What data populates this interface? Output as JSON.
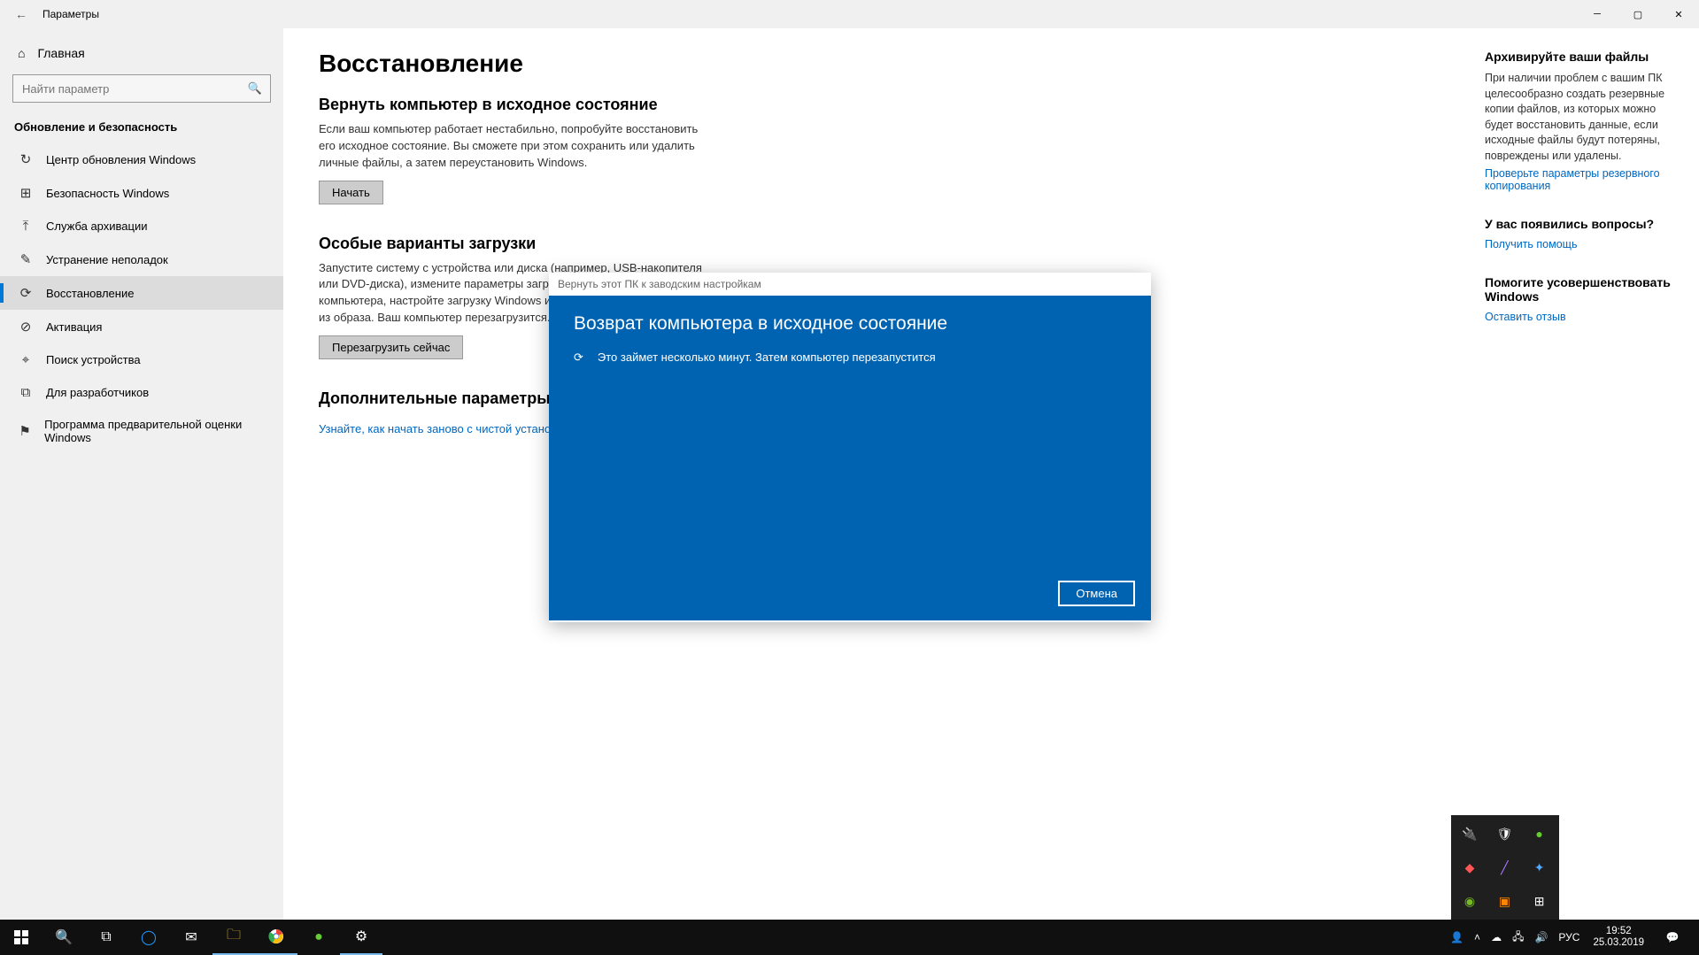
{
  "titlebar": {
    "title": "Параметры"
  },
  "sidebar": {
    "home": "Главная",
    "search_placeholder": "Найти параметр",
    "section": "Обновление и безопасность",
    "items": [
      {
        "icon": "↻",
        "label": "Центр обновления Windows"
      },
      {
        "icon": "⊞",
        "label": "Безопасность Windows"
      },
      {
        "icon": "⤒",
        "label": "Служба архивации"
      },
      {
        "icon": "✎",
        "label": "Устранение неполадок"
      },
      {
        "icon": "⟳",
        "label": "Восстановление"
      },
      {
        "icon": "⊘",
        "label": "Активация"
      },
      {
        "icon": "⌖",
        "label": "Поиск устройства"
      },
      {
        "icon": "⧉",
        "label": "Для разработчиков"
      },
      {
        "icon": "⚑",
        "label": "Программа предварительной оценки Windows"
      }
    ],
    "active_index": 4
  },
  "main": {
    "h1": "Восстановление",
    "sec1_title": "Вернуть компьютер в исходное состояние",
    "sec1_text": "Если ваш компьютер работает нестабильно, попробуйте восстановить его исходное состояние. Вы сможете при этом сохранить или удалить личные файлы, а затем переустановить Windows.",
    "sec1_btn": "Начать",
    "sec2_title": "Особые варианты загрузки",
    "sec2_text": "Запустите систему с устройства или диска (например, USB-накопителя или DVD-диска), измените параметры загрузки Windows, ПО компьютера, настройте загрузку Windows или восстановление системы из образа. Ваш компьютер перезагрузится.",
    "sec2_btn": "Перезагрузить сейчас",
    "sec3_title": "Дополнительные параметры восстановления",
    "sec3_link": "Узнайте, как начать заново с чистой установкой Windows"
  },
  "right": {
    "b1_title": "Архивируйте ваши файлы",
    "b1_text": "При наличии проблем с вашим ПК целесообразно создать резервные копии файлов, из которых можно будет восстановить данные, если исходные файлы будут потеряны, повреждены или удалены.",
    "b1_link": "Проверьте параметры резервного копирования",
    "b2_title": "У вас появились вопросы?",
    "b2_link": "Получить помощь",
    "b3_title": "Помогите усовершенствовать Windows",
    "b3_link": "Оставить отзыв"
  },
  "dialog": {
    "title": "Вернуть этот ПК к заводским настройкам",
    "heading": "Возврат компьютера в исходное состояние",
    "message": "Это займет несколько минут. Затем компьютер перезапустится",
    "cancel": "Отмена"
  },
  "taskbar": {
    "lang": "РУС",
    "time": "19:52",
    "date": "25.03.2019"
  }
}
